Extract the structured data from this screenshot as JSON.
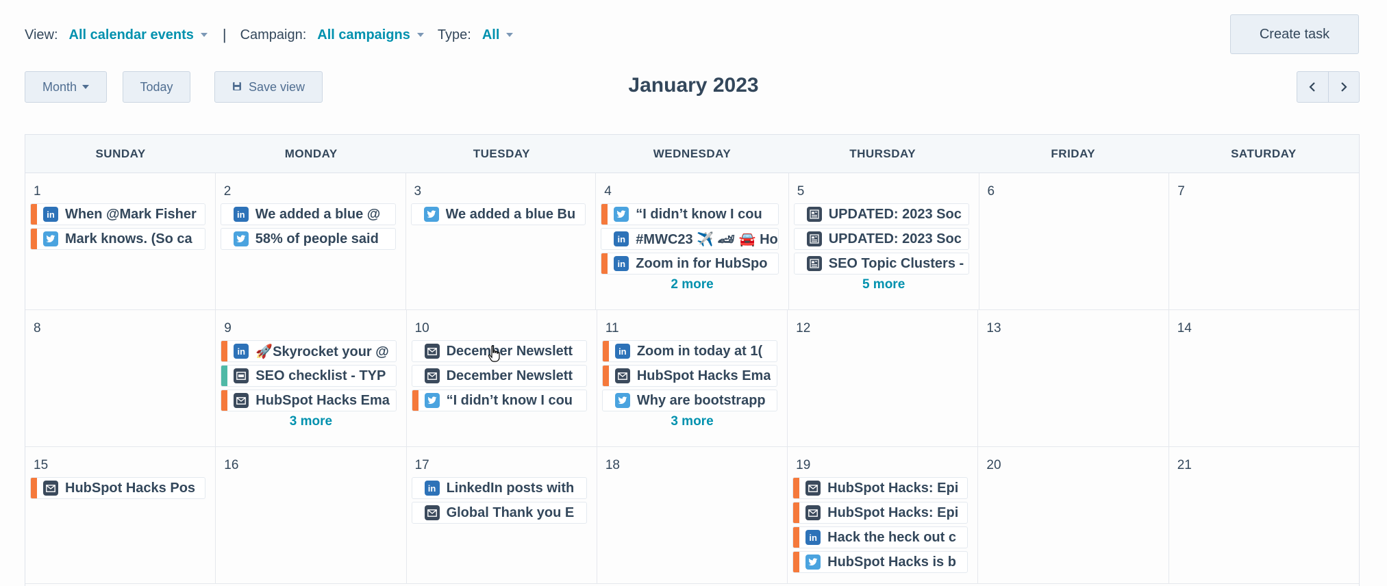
{
  "filters": {
    "view_label": "View:",
    "view_value": "All calendar events",
    "campaign_label": "Campaign:",
    "campaign_value": "All campaigns",
    "type_label": "Type:",
    "type_value": "All",
    "separator": "|"
  },
  "toolbar": {
    "month_label": "Month",
    "today_label": "Today",
    "save_view_label": "Save view",
    "create_task_label": "Create task",
    "title": "January 2023"
  },
  "colors": {
    "orange": "#f5793b",
    "teal": "#4fb9a6",
    "link": "#0091ae"
  },
  "weekdays": [
    "SUNDAY",
    "MONDAY",
    "TUESDAY",
    "WEDNESDAY",
    "THURSDAY",
    "FRIDAY",
    "SATURDAY"
  ],
  "weeks": [
    [
      {
        "day": "1",
        "events": [
          {
            "title": "When @Mark Fisher",
            "icon": "linkedin-icon",
            "bar": "orange"
          },
          {
            "title": "Mark knows. (So ca",
            "icon": "twitter-icon",
            "bar": "orange"
          }
        ]
      },
      {
        "day": "2",
        "events": [
          {
            "title": "We added a blue @",
            "icon": "linkedin-icon",
            "bar": ""
          },
          {
            "title": "58% of people said",
            "icon": "twitter-icon",
            "bar": ""
          }
        ]
      },
      {
        "day": "3",
        "events": [
          {
            "title": "We added a blue Bu",
            "icon": "twitter-icon",
            "bar": ""
          }
        ]
      },
      {
        "day": "4",
        "events": [
          {
            "title": "“I didn’t know I cou",
            "icon": "twitter-icon",
            "bar": "orange"
          },
          {
            "title": "#MWC23 ✈️ 🏎 🚘 Ho",
            "icon": "linkedin-icon",
            "bar": ""
          },
          {
            "title": "Zoom in for HubSpo",
            "icon": "linkedin-icon",
            "bar": "orange"
          }
        ],
        "more": "2 more"
      },
      {
        "day": "5",
        "events": [
          {
            "title": "UPDATED: 2023 Soc",
            "icon": "document-icon",
            "bar": ""
          },
          {
            "title": "UPDATED: 2023 Soc",
            "icon": "document-icon",
            "bar": ""
          },
          {
            "title": "SEO Topic Clusters -",
            "icon": "document-icon",
            "bar": ""
          }
        ],
        "more": "5 more"
      },
      {
        "day": "6",
        "events": []
      },
      {
        "day": "7",
        "events": []
      }
    ],
    [
      {
        "day": "8",
        "events": []
      },
      {
        "day": "9",
        "events": [
          {
            "title": "🚀Skyrocket your @",
            "icon": "linkedin-icon",
            "bar": "orange"
          },
          {
            "title": "SEO checklist - TYP",
            "icon": "page-icon",
            "bar": "teal"
          },
          {
            "title": "HubSpot Hacks Ema",
            "icon": "email-icon",
            "bar": "orange"
          }
        ],
        "more": "3 more"
      },
      {
        "day": "10",
        "events": [
          {
            "title": "December Newslett",
            "icon": "email-icon",
            "bar": ""
          },
          {
            "title": "December Newslett",
            "icon": "email-icon",
            "bar": ""
          },
          {
            "title": "“I didn’t know I cou",
            "icon": "twitter-icon",
            "bar": "orange"
          }
        ]
      },
      {
        "day": "11",
        "events": [
          {
            "title": "Zoom in today at 1(",
            "icon": "linkedin-icon",
            "bar": "orange"
          },
          {
            "title": "HubSpot Hacks Ema",
            "icon": "email-icon",
            "bar": "orange"
          },
          {
            "title": "Why are bootstrapp",
            "icon": "twitter-icon",
            "bar": ""
          }
        ],
        "more": "3 more"
      },
      {
        "day": "12",
        "events": []
      },
      {
        "day": "13",
        "events": []
      },
      {
        "day": "14",
        "events": []
      }
    ],
    [
      {
        "day": "15",
        "events": [
          {
            "title": "HubSpot Hacks Pos",
            "icon": "email-icon",
            "bar": "orange"
          }
        ]
      },
      {
        "day": "16",
        "events": []
      },
      {
        "day": "17",
        "events": [
          {
            "title": "LinkedIn posts with",
            "icon": "linkedin-icon",
            "bar": ""
          },
          {
            "title": "Global Thank you E",
            "icon": "email-icon",
            "bar": ""
          }
        ]
      },
      {
        "day": "18",
        "events": []
      },
      {
        "day": "19",
        "events": [
          {
            "title": "HubSpot Hacks: Epi",
            "icon": "email-icon",
            "bar": "orange"
          },
          {
            "title": "HubSpot Hacks: Epi",
            "icon": "email-icon",
            "bar": "orange"
          },
          {
            "title": "Hack the heck out c",
            "icon": "linkedin-icon",
            "bar": "orange"
          },
          {
            "title": "HubSpot Hacks is b",
            "icon": "twitter-icon",
            "bar": "orange"
          }
        ]
      },
      {
        "day": "20",
        "events": []
      },
      {
        "day": "21",
        "events": []
      }
    ]
  ]
}
